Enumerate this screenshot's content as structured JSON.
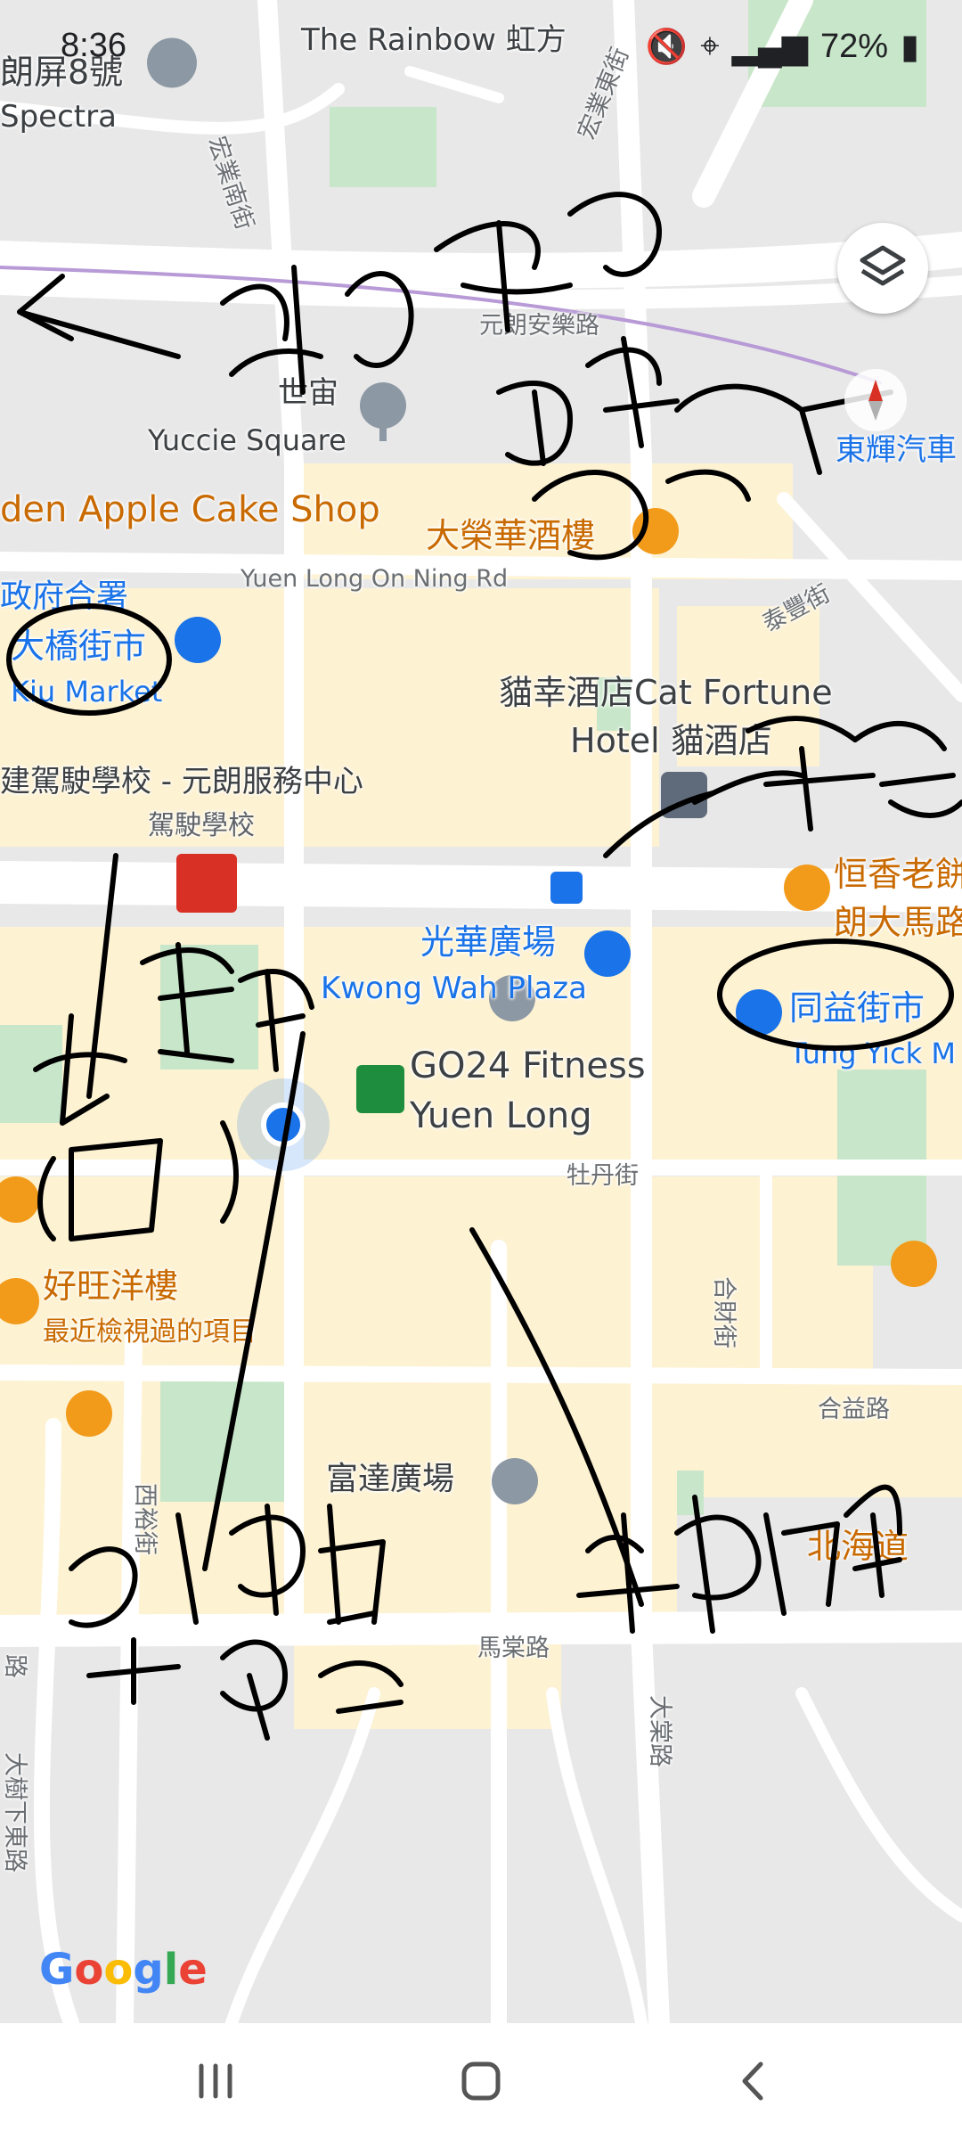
{
  "status_bar": {
    "time": "8:36",
    "battery": "72%",
    "icons": [
      "mute-icon",
      "location-icon",
      "wifi-icon",
      "signal-icon",
      "battery-icon"
    ]
  },
  "map": {
    "labels": {
      "rainbow": "The Rainbow 虹方",
      "rainbow_top": "虹方",
      "spectra_zh": "朗屏8號",
      "spectra_en": "Spectra",
      "hung_yip_s": "宏業南街",
      "hung_yip_e": "宏業東街",
      "yuen_long_on_lok": "元朗安樂路",
      "sai_chau": "世宙",
      "yuccie": "Yuccie Square",
      "golden_apple": "den Apple Cake Shop",
      "tai_wing_wah": "大榮華酒樓",
      "on_ning_rd": "Yuen Long On Ning Rd",
      "tai_fung": "泰豐街",
      "govt_offices": "政府合署",
      "tai_kiu_market": "大橋街市",
      "kiu_market": "Kiu Market",
      "cat_fortune_1": "貓幸酒店Cat Fortune",
      "cat_fortune_2": "Hotel 貓酒店",
      "driving_school": "建駕駛學校 - 元朗服務中心",
      "driving_school_sub": "駕駛學校",
      "hang_heung_1": "恒香老餅",
      "hang_heung_2": "朗大馬路",
      "kwong_wah_zh": "光華廣場",
      "kwong_wah_en": "Kwong Wah Plaza",
      "tung_yick_zh": "同益街市",
      "tung_yick_en": "Tung Yick M",
      "go24_1": "GO24 Fitness",
      "go24_2": "Yuen Long",
      "mau_tan": "牡丹街",
      "ho_wong": "好旺洋樓",
      "recent": "最近檢視過的項目",
      "hop_choi": "合財街",
      "hop_yick": "合益路",
      "sai_yu": "西裕街",
      "fu_tat": "富達廣場",
      "ma_tong": "馬棠路",
      "tai_tong": "大棠路",
      "tai_shu_ha_e": "大樹下東路",
      "hokkaido": "北海道",
      "rd_fragment": "路",
      "tung_wai": "東輝汽車"
    },
    "handwriting": {
      "xitie_lang": "西鐵(朗屏)",
      "xitie_yl": "西鐵(元朗)",
      "qingtie": "輕鐵",
      "tai_ma_lo": "大馬路(巴士)",
      "minibus": "小巴的士總站",
      "niu_yi": "牛仔廣場"
    }
  },
  "google_logo": "Google",
  "controls": {
    "layers": "layers-icon",
    "compass": "compass-icon"
  },
  "nav": {
    "recent": "recent-apps-icon",
    "home": "home-icon",
    "back": "back-icon"
  },
  "colors": {
    "road": "#ffffff",
    "block": "#fdf2d2",
    "park": "#c8e6c9",
    "ink": "#000000",
    "accent": "#1a73e8",
    "poi_orange": "#f29b1b"
  }
}
